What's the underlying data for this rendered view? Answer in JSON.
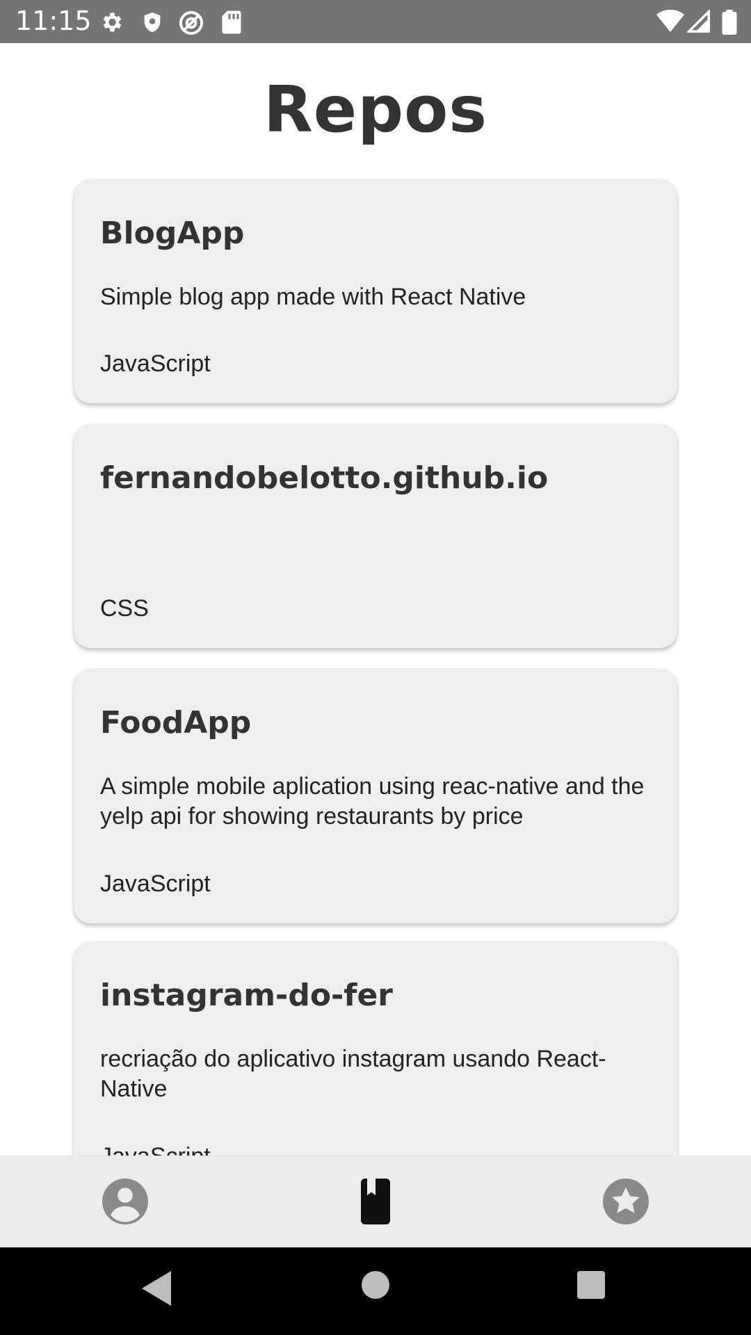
{
  "status_bar": {
    "time": "11:15",
    "icons": [
      "settings-icon",
      "shield-icon",
      "at-sign-icon",
      "sd-card-icon",
      "wifi-icon",
      "signal-icon",
      "battery-icon"
    ]
  },
  "page": {
    "title": "Repos"
  },
  "repos": [
    {
      "name": "BlogApp",
      "description": "Simple blog app made with React Native",
      "language": "JavaScript"
    },
    {
      "name": "fernandobelotto.github.io",
      "description": "",
      "language": "CSS"
    },
    {
      "name": "FoodApp",
      "description": "A simple mobile aplication using reac-native and the yelp api for showing restaurants by price",
      "language": "JavaScript"
    },
    {
      "name": "instagram-do-fer",
      "description": "recriação do aplicativo instagram usando React-Native",
      "language": "JavaScript"
    }
  ],
  "tab_bar": {
    "tabs": [
      {
        "icon": "account-icon",
        "active": false
      },
      {
        "icon": "book-icon",
        "active": true
      },
      {
        "icon": "star-icon",
        "active": false
      }
    ],
    "colors": {
      "active": "#111111",
      "inactive": "#8a8a8a"
    }
  },
  "nav_bar": {
    "icons": [
      "back-icon",
      "home-icon",
      "recents-icon"
    ]
  }
}
